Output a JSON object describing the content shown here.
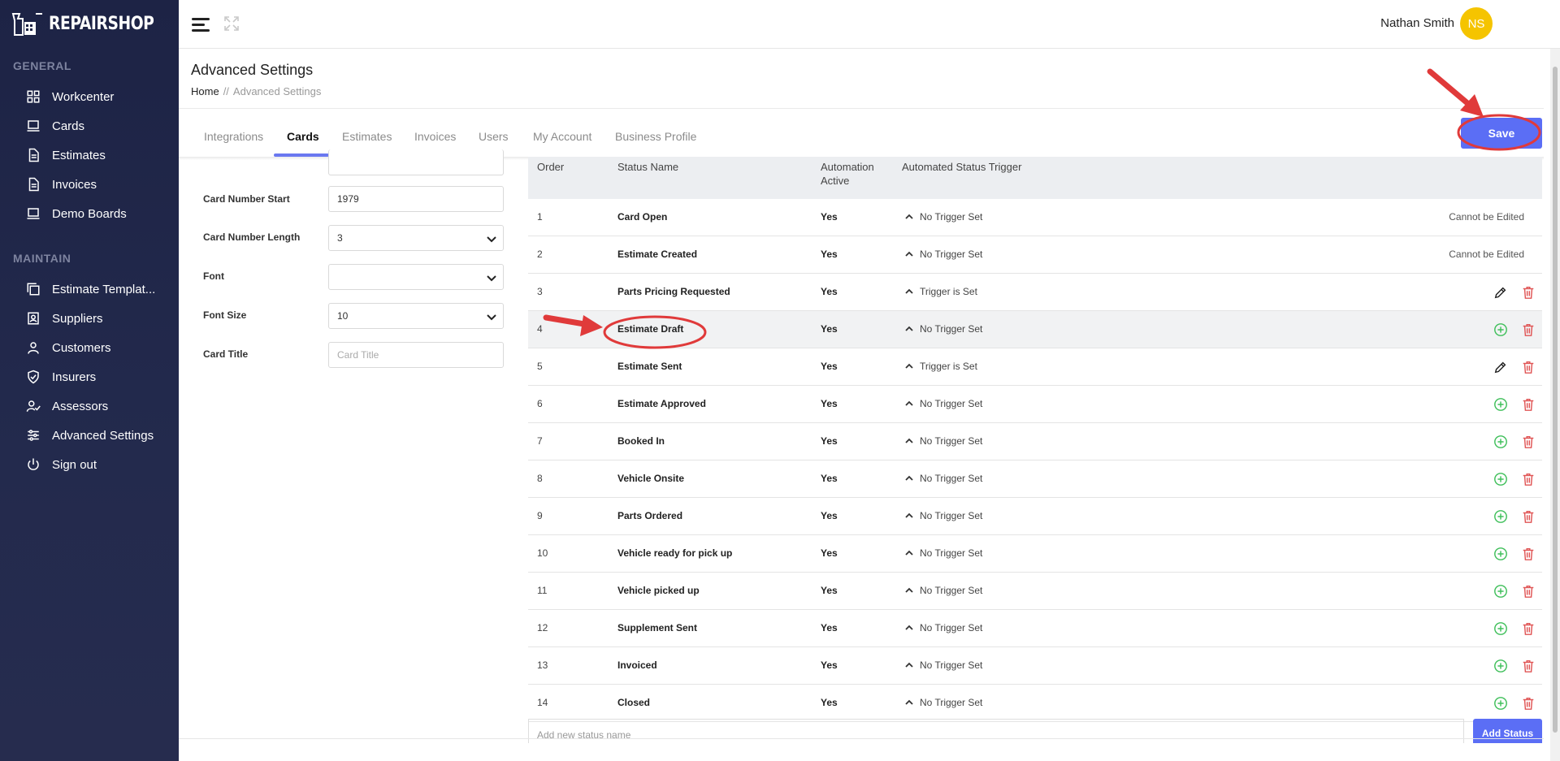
{
  "app": {
    "logo_text": "REPAIRSHOP"
  },
  "sidebar": {
    "sections": [
      {
        "title": "GENERAL",
        "items": [
          {
            "label": "Workcenter",
            "icon": "grid-icon"
          },
          {
            "label": "Cards",
            "icon": "laptop-icon"
          },
          {
            "label": "Estimates",
            "icon": "document-icon"
          },
          {
            "label": "Invoices",
            "icon": "document-icon"
          },
          {
            "label": "Demo Boards",
            "icon": "laptop-icon"
          }
        ]
      },
      {
        "title": "MAINTAIN",
        "items": [
          {
            "label": "Estimate Templat...",
            "icon": "copy-icon"
          },
          {
            "label": "Suppliers",
            "icon": "contact-icon"
          },
          {
            "label": "Customers",
            "icon": "user-icon"
          },
          {
            "label": "Insurers",
            "icon": "shield-icon"
          },
          {
            "label": "Assessors",
            "icon": "user-check-icon"
          },
          {
            "label": "Advanced Settings",
            "icon": "sliders-icon"
          },
          {
            "label": "Sign out",
            "icon": "power-icon"
          }
        ]
      }
    ]
  },
  "header": {
    "user_name": "Nathan Smith",
    "avatar_initials": "NS",
    "avatar_color": "#f5c400"
  },
  "page": {
    "title": "Advanced Settings",
    "breadcrumb_home": "Home",
    "breadcrumb_sep": "//",
    "breadcrumb_current": "Advanced Settings"
  },
  "tabs": [
    "Integrations",
    "Cards",
    "Estimates",
    "Invoices",
    "Users",
    "My Account",
    "Business Profile"
  ],
  "active_tab": "Cards",
  "save_label": "Save",
  "accent_color": "#5b6ef5",
  "form": {
    "card_number_start_label": "Card Number Start",
    "card_number_start_value": "1979",
    "card_number_length_label": "Card Number Length",
    "card_number_length_value": "3",
    "font_label": "Font",
    "font_value": "",
    "font_size_label": "Font Size",
    "font_size_value": "10",
    "card_title_label": "Card Title",
    "card_title_placeholder": "Card Title"
  },
  "table": {
    "headers": {
      "order": "Order",
      "status_name": "Status Name",
      "automation_active_1": "Automation",
      "automation_active_2": "Active",
      "trigger": "Automated Status Trigger"
    },
    "rows": [
      {
        "order": "1",
        "name": "Card Open",
        "active": "Yes",
        "trigger": "No Trigger Set",
        "note": "Cannot be Edited",
        "action": "none"
      },
      {
        "order": "2",
        "name": "Estimate Created",
        "active": "Yes",
        "trigger": "No Trigger Set",
        "note": "Cannot be Edited",
        "action": "none"
      },
      {
        "order": "3",
        "name": "Parts Pricing Requested",
        "active": "Yes",
        "trigger": "Trigger is Set",
        "note": "",
        "action": "edit"
      },
      {
        "order": "4",
        "name": "Estimate Draft",
        "active": "Yes",
        "trigger": "No Trigger Set",
        "note": "",
        "action": "add"
      },
      {
        "order": "5",
        "name": "Estimate Sent",
        "active": "Yes",
        "trigger": "Trigger is Set",
        "note": "",
        "action": "edit"
      },
      {
        "order": "6",
        "name": "Estimate Approved",
        "active": "Yes",
        "trigger": "No Trigger Set",
        "note": "",
        "action": "add"
      },
      {
        "order": "7",
        "name": "Booked In",
        "active": "Yes",
        "trigger": "No Trigger Set",
        "note": "",
        "action": "add"
      },
      {
        "order": "8",
        "name": "Vehicle Onsite",
        "active": "Yes",
        "trigger": "No Trigger Set",
        "note": "",
        "action": "add"
      },
      {
        "order": "9",
        "name": "Parts Ordered",
        "active": "Yes",
        "trigger": "No Trigger Set",
        "note": "",
        "action": "add"
      },
      {
        "order": "10",
        "name": "Vehicle ready for pick up",
        "active": "Yes",
        "trigger": "No Trigger Set",
        "note": "",
        "action": "add"
      },
      {
        "order": "11",
        "name": "Vehicle picked up",
        "active": "Yes",
        "trigger": "No Trigger Set",
        "note": "",
        "action": "add"
      },
      {
        "order": "12",
        "name": "Supplement Sent",
        "active": "Yes",
        "trigger": "No Trigger Set",
        "note": "",
        "action": "add"
      },
      {
        "order": "13",
        "name": "Invoiced",
        "active": "Yes",
        "trigger": "No Trigger Set",
        "note": "",
        "action": "add"
      },
      {
        "order": "14",
        "name": "Closed",
        "active": "Yes",
        "trigger": "No Trigger Set",
        "note": "",
        "action": "add"
      }
    ],
    "add_placeholder": "Add new status name",
    "add_button": "Add Status",
    "highlight_row": 3
  }
}
